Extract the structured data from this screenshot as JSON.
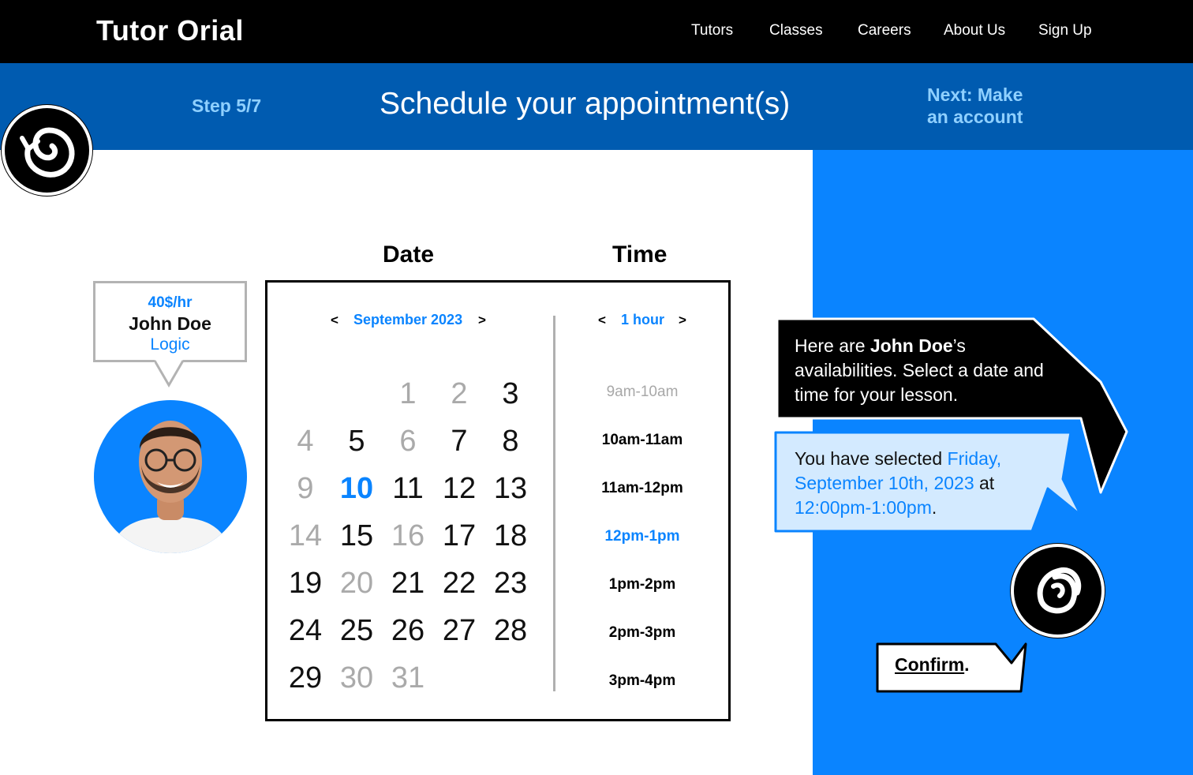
{
  "nav": {
    "brand": "Tutor Orial",
    "links": [
      "Tutors",
      "Classes",
      "Careers",
      "About Us",
      "Sign Up"
    ]
  },
  "step": {
    "label": "Step 5/7",
    "title": "Schedule your appointment(s)",
    "next_line1": "Next: Make",
    "next_line2": "an account"
  },
  "headings": {
    "date": "Date",
    "time": "Time"
  },
  "tutor": {
    "rate": "40$/hr",
    "name": "John Doe",
    "subject": "Logic"
  },
  "calendar": {
    "prev": "<",
    "next": ">",
    "month": "September 2023",
    "days": [
      {
        "d": "1",
        "s": "inactive"
      },
      {
        "d": "2",
        "s": "inactive"
      },
      {
        "d": "3",
        "s": "active"
      },
      {
        "d": "4",
        "s": "inactive"
      },
      {
        "d": "5",
        "s": "active"
      },
      {
        "d": "6",
        "s": "inactive"
      },
      {
        "d": "7",
        "s": "active"
      },
      {
        "d": "8",
        "s": "active"
      },
      {
        "d": "9",
        "s": "inactive"
      },
      {
        "d": "10",
        "s": "selected"
      },
      {
        "d": "11",
        "s": "active"
      },
      {
        "d": "12",
        "s": "active"
      },
      {
        "d": "13",
        "s": "active"
      },
      {
        "d": "14",
        "s": "inactive"
      },
      {
        "d": "15",
        "s": "active"
      },
      {
        "d": "16",
        "s": "inactive"
      },
      {
        "d": "17",
        "s": "active"
      },
      {
        "d": "18",
        "s": "active"
      },
      {
        "d": "19",
        "s": "active"
      },
      {
        "d": "20",
        "s": "inactive"
      },
      {
        "d": "21",
        "s": "active"
      },
      {
        "d": "22",
        "s": "active"
      },
      {
        "d": "23",
        "s": "active"
      },
      {
        "d": "24",
        "s": "active"
      },
      {
        "d": "25",
        "s": "active"
      },
      {
        "d": "26",
        "s": "active"
      },
      {
        "d": "27",
        "s": "active"
      },
      {
        "d": "28",
        "s": "active"
      },
      {
        "d": "29",
        "s": "active"
      },
      {
        "d": "30",
        "s": "inactive"
      },
      {
        "d": "31",
        "s": "inactive"
      }
    ]
  },
  "time": {
    "prev": "<",
    "next": ">",
    "duration": "1 hour",
    "slots": [
      {
        "label": "9am-10am",
        "s": "unavail"
      },
      {
        "label": "10am-11am",
        "s": "avail"
      },
      {
        "label": "11am-12pm",
        "s": "avail"
      },
      {
        "label": "12pm-1pm",
        "s": "selected"
      },
      {
        "label": "1pm-2pm",
        "s": "avail"
      },
      {
        "label": "2pm-3pm",
        "s": "avail"
      },
      {
        "label": "3pm-4pm",
        "s": "avail"
      }
    ]
  },
  "bubble1": {
    "p1": "Here are ",
    "name": "John Doe",
    "p2": "’s availabilities. Select a date and time for your lesson."
  },
  "bubble2": {
    "p1": "You have selected ",
    "date": "Friday, September 10th, 2023",
    "p2": " at ",
    "time": "12:00pm-1:00pm",
    "p3": "."
  },
  "confirm": {
    "label": "Confirm",
    "suffix": "."
  },
  "colors": {
    "accent": "#0a84ff",
    "stepbar": "#005bb0",
    "next_text": "#8fd0ff",
    "header": "#000000"
  },
  "icons": [
    "back-swirl-icon",
    "swirl-icon",
    "tutor-avatar"
  ]
}
